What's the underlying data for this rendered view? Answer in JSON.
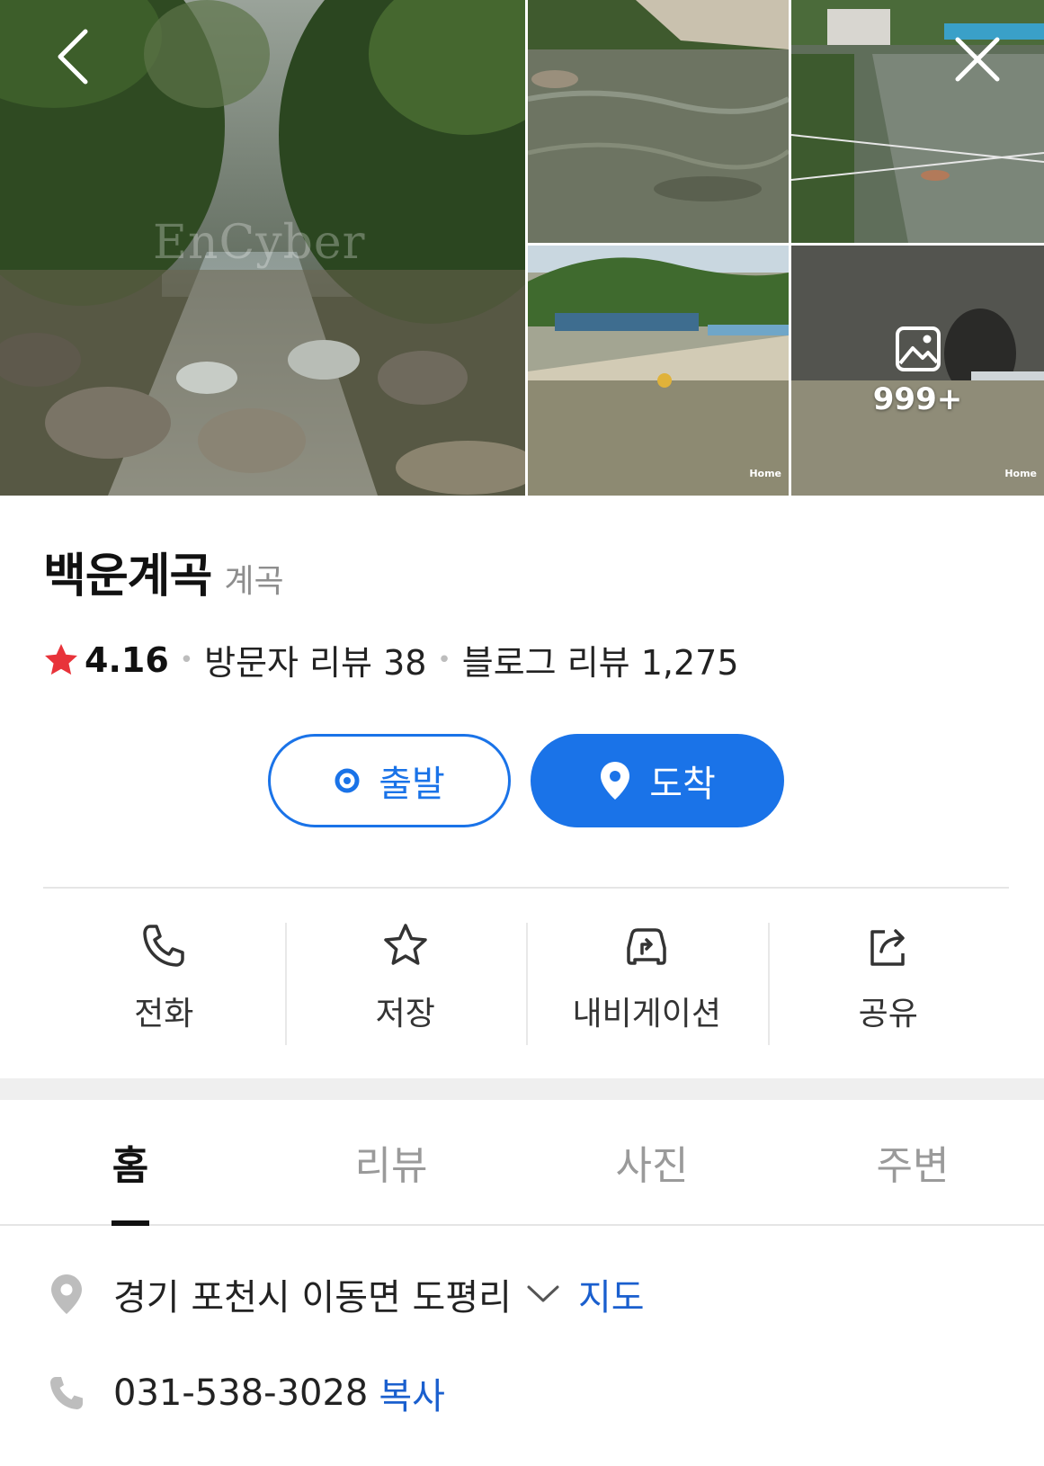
{
  "gallery": {
    "watermark": "EnCyber",
    "more_count": "999+",
    "home_label": "Home"
  },
  "place": {
    "name": "백운계곡",
    "category": "계곡",
    "rating": "4.16",
    "visitor_reviews": "방문자 리뷰 38",
    "blog_reviews": "블로그 리뷰 1,275"
  },
  "route": {
    "depart_label": "출발",
    "arrive_label": "도착"
  },
  "actions": {
    "call": "전화",
    "save": "저장",
    "navigation": "내비게이션",
    "share": "공유"
  },
  "tabs": [
    {
      "label": "홈"
    },
    {
      "label": "리뷰"
    },
    {
      "label": "사진"
    },
    {
      "label": "주변"
    }
  ],
  "info": {
    "address": "경기 포천시 이동면 도평리",
    "map_link": "지도",
    "phone": "031-538-3028",
    "copy_link": "복사"
  },
  "colors": {
    "accent": "#1a73e8",
    "star": "#e8333a",
    "link": "#1a5fce"
  }
}
